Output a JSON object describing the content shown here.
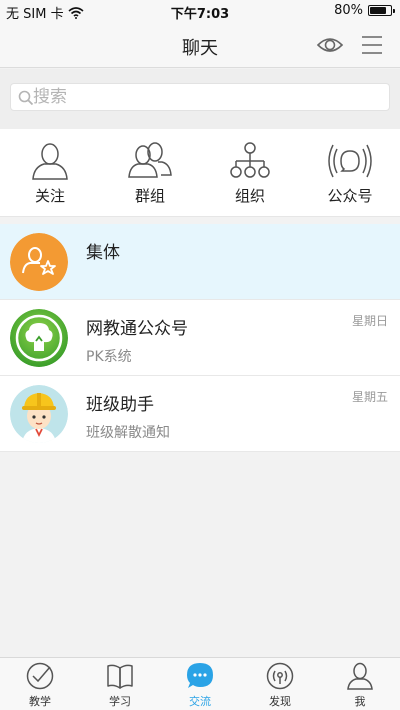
{
  "status_bar": {
    "carrier": "无 SIM 卡",
    "time": "下午7:03",
    "battery": "80%",
    "battery_level": 0.8
  },
  "nav": {
    "title": "聊天"
  },
  "search": {
    "placeholder": "搜索"
  },
  "shortcuts": [
    {
      "label": "关注",
      "icon": "person-icon"
    },
    {
      "label": "群组",
      "icon": "group-icon"
    },
    {
      "label": "组织",
      "icon": "org-tree-icon"
    },
    {
      "label": "公众号",
      "icon": "broadcast-icon"
    }
  ],
  "conversations": [
    {
      "name": "集体",
      "preview": "",
      "time": "",
      "avatar": "collective-avatar"
    },
    {
      "name": "网教通公众号",
      "preview": "PK系统",
      "time": "星期日",
      "avatar": "tree-logo-avatar"
    },
    {
      "name": "班级助手",
      "preview": "班级解散通知",
      "time": "星期五",
      "avatar": "helper-avatar"
    }
  ],
  "tabs": [
    {
      "label": "教学",
      "icon": "checkmark-circle-icon"
    },
    {
      "label": "学习",
      "icon": "book-icon"
    },
    {
      "label": "交流",
      "icon": "chat-bubble-icon",
      "active": true
    },
    {
      "label": "发现",
      "icon": "radar-icon"
    },
    {
      "label": "我",
      "icon": "user-icon"
    }
  ],
  "colors": {
    "accent": "#2aa3e6",
    "active_row": "#e6f6fd",
    "collective_avatar": "#f39a33",
    "tree_avatar": "#4caf32"
  }
}
